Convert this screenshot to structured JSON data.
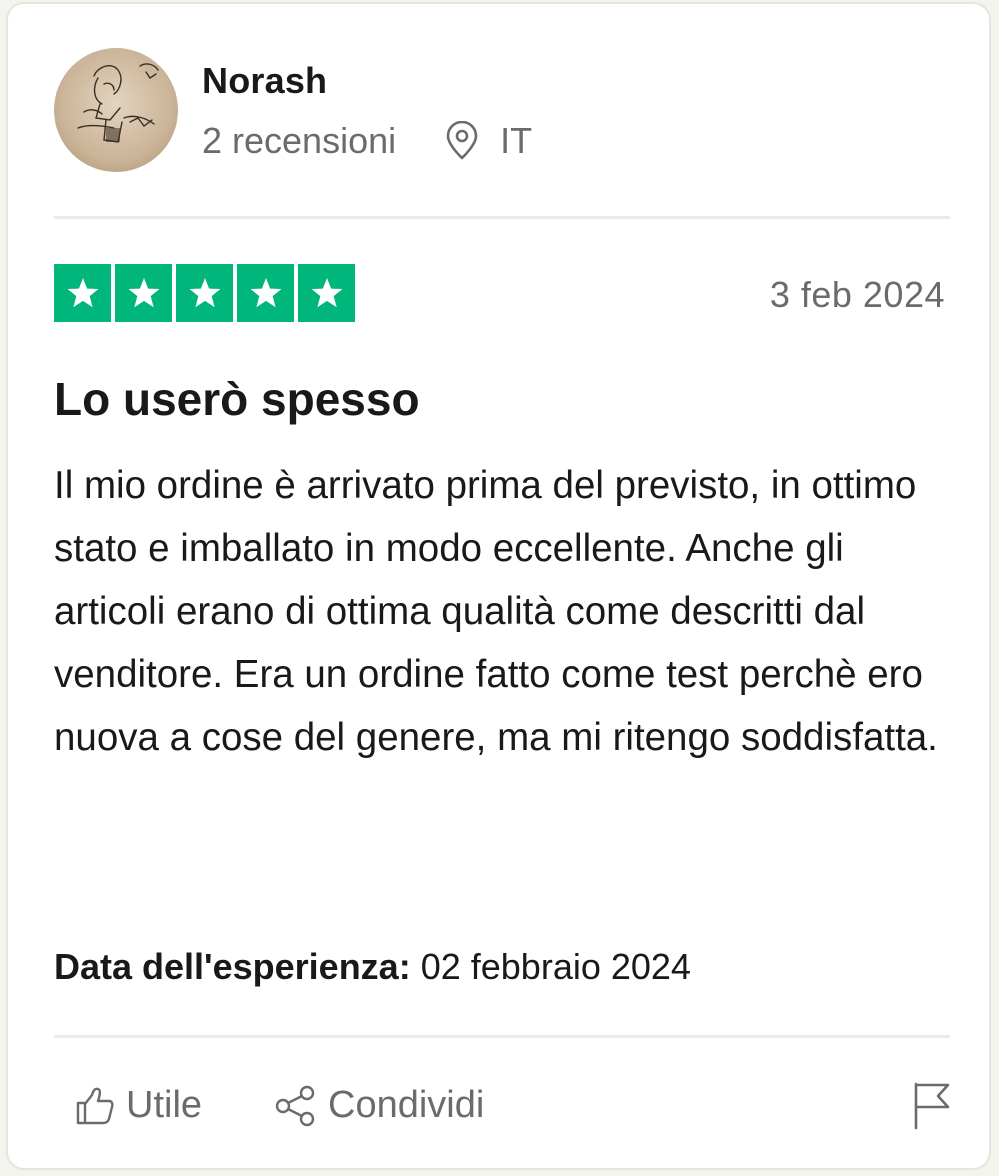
{
  "user": {
    "name": "Norash",
    "reviews_count": "2 recensioni",
    "country": "IT"
  },
  "review": {
    "rating": 5,
    "max_rating": 5,
    "date": "3 feb 2024",
    "title": "Lo userò spesso",
    "body": "Il mio ordine è arrivato prima del previsto, in ottimo stato e imballato in modo eccellente. Anche gli articoli erano di ottima qualità come descritti dal venditore. Era un ordine fatto come test perchè ero nuova a cose del genere, ma mi ritengo soddisfatta.",
    "experience_label": "Data dell'esperienza:",
    "experience_date": "02 febbraio 2024"
  },
  "actions": {
    "useful_label": "Utile",
    "share_label": "Condividi"
  },
  "icons": {
    "location": "location-pin-icon",
    "useful": "thumbs-up-icon",
    "share": "share-icon",
    "report": "flag-icon",
    "star": "star-icon"
  },
  "colors": {
    "star_green": "#00b67a",
    "text_primary": "#191919",
    "text_secondary": "#6b6b6b",
    "divider": "#ececE4"
  }
}
